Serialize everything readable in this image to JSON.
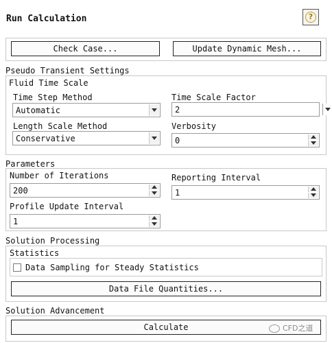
{
  "header": {
    "title": "Run Calculation",
    "help_glyph": "?"
  },
  "top_buttons": {
    "check_case": "Check Case...",
    "update_dynamic_mesh": "Update Dynamic Mesh..."
  },
  "pseudo_transient": {
    "section_title": "Pseudo Transient Settings",
    "group_title": "Fluid Time Scale",
    "time_step_method": {
      "label": "Time Step Method",
      "value": "Automatic"
    },
    "time_scale_factor": {
      "label": "Time Scale Factor",
      "value": "2"
    },
    "length_scale_method": {
      "label": "Length Scale Method",
      "value": "Conservative"
    },
    "verbosity": {
      "label": "Verbosity",
      "value": "0"
    }
  },
  "parameters": {
    "section_title": "Parameters",
    "number_of_iterations": {
      "label": "Number of Iterations",
      "value": "200"
    },
    "reporting_interval": {
      "label": "Reporting Interval",
      "value": "1"
    },
    "profile_update_interval": {
      "label": "Profile Update Interval",
      "value": "1"
    }
  },
  "solution_processing": {
    "section_title": "Solution Processing",
    "group_title": "Statistics",
    "data_sampling_label": "Data Sampling for Steady Statistics",
    "data_sampling_checked": false,
    "data_file_quantities": "Data File Quantities..."
  },
  "solution_advancement": {
    "section_title": "Solution Advancement",
    "calculate": "Calculate"
  },
  "watermark": {
    "text": "CFD之道",
    "icon": "wechat-icon"
  }
}
